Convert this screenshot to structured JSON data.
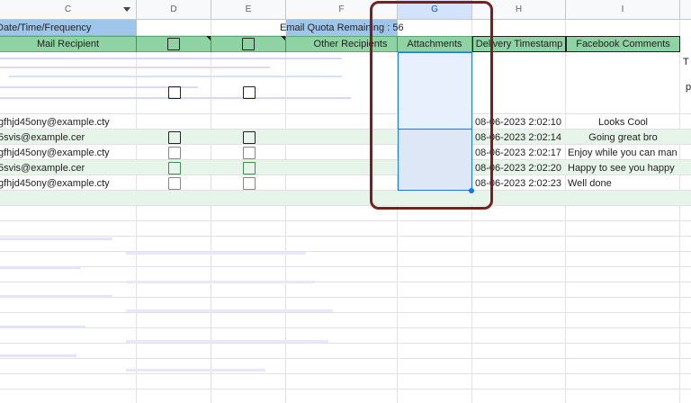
{
  "column_headers": [
    "C",
    "D",
    "E",
    "F",
    "G",
    "H",
    "I"
  ],
  "filter_icon": "filter-dropdown-icon",
  "header_row1": {
    "date_time": "Date/Time/Frequency",
    "quota": "Email Quota Remaining : 56"
  },
  "header_row2": {
    "mail_recipient": "Mail Recipient",
    "other_recipients": "Other Recipients",
    "attachments": "Attachments",
    "delivery_timestamp": "Delivery Timestamp",
    "facebook_comments": "Facebook Comments"
  },
  "edge_text": {
    "t": "T",
    "p": "p"
  },
  "rows": [
    {
      "email": "gfhjd45ony@example.cty",
      "timestamp": "08-06-2023 2:02:10",
      "comment": "Looks Cool"
    },
    {
      "email": "5svis@example.cer",
      "timestamp": "08-06-2023 2:02:14",
      "comment": "Going great bro"
    },
    {
      "email": "gfhjd45ony@example.cty",
      "timestamp": "08-06-2023 2:02:17",
      "comment": "Enjoy while you can man"
    },
    {
      "email": "5svis@example.cer",
      "timestamp": "08-06-2023 2:02:20",
      "comment": "Happy to see you happy"
    },
    {
      "email": "gfhjd45ony@example.cty",
      "timestamp": "08-06-2023 2:02:23",
      "comment": "Well done"
    }
  ],
  "colors": {
    "header_blue": "#9fc5e8",
    "header_green": "#8fd2a4",
    "stripe_green": "#e7f4ea",
    "selection_blue": "#e8f0fe",
    "annotation_border": "#7a1f1f"
  }
}
